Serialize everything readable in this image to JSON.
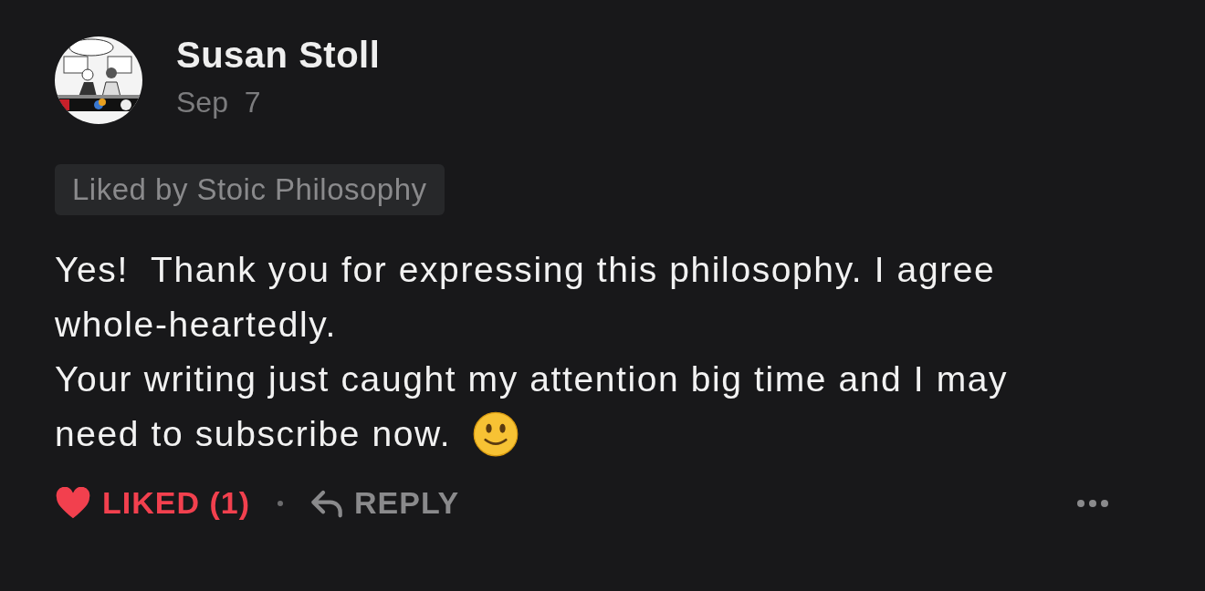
{
  "comment": {
    "author": "Susan Stoll",
    "date": "Sep  7",
    "liked_by": "Liked by Stoic Philosophy",
    "lines": [
      "Yes!  Thank you for expressing this philosophy. I agree",
      "whole-heartedly.",
      "Your writing just caught my attention big time and I may",
      "need to subscribe now."
    ],
    "like_button": {
      "label": "LIKED (1)",
      "liked": true
    },
    "reply_button": {
      "label": "REPLY"
    }
  }
}
